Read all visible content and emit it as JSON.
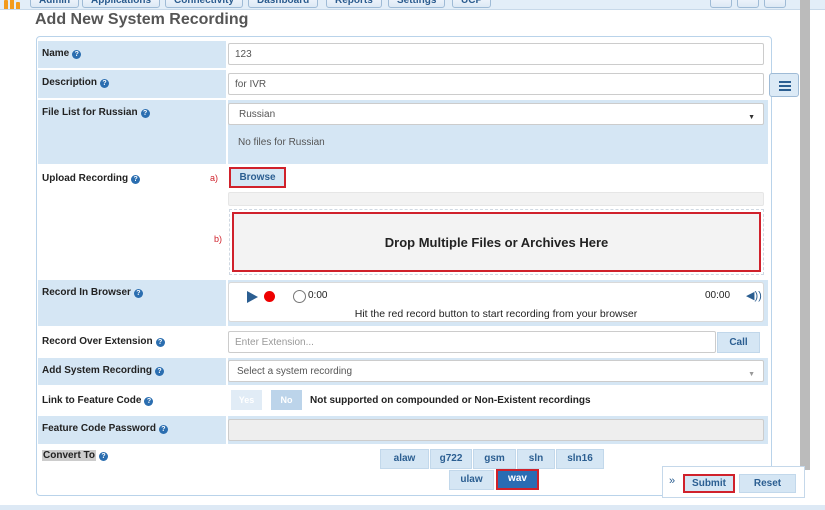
{
  "nav": {
    "tabs": [
      "Admin",
      "Applications",
      "Connectivity",
      "Dashboard",
      "Reports",
      "Settings",
      "UCP"
    ]
  },
  "page": {
    "title": "Add New System Recording"
  },
  "form": {
    "name": {
      "label": "Name",
      "value": "123"
    },
    "description": {
      "label": "Description",
      "value": "for IVR"
    },
    "file_list": {
      "label": "File List for Russian",
      "selected": "Russian",
      "note": "No files for Russian"
    },
    "upload": {
      "label": "Upload Recording",
      "marker_a": "a)",
      "marker_b": "b)",
      "browse_label": "Browse",
      "dropzone_text": "Drop Multiple Files or Archives Here"
    },
    "record_browser": {
      "label": "Record In Browser",
      "time_current": "0:00",
      "time_total": "00:00",
      "hint": "Hit the red record button to start recording from your browser"
    },
    "record_extension": {
      "label": "Record Over Extension",
      "placeholder": "Enter Extension...",
      "call_label": "Call"
    },
    "add_system_recording": {
      "label": "Add System Recording",
      "placeholder": "Select a system recording"
    },
    "feature_code": {
      "label": "Link to Feature Code",
      "yes": "Yes",
      "no": "No",
      "note": "Not supported on compounded or Non-Existent recordings"
    },
    "feature_password": {
      "label": "Feature Code Password"
    },
    "convert": {
      "label": "Convert To",
      "formats_row1": [
        "alaw",
        "g722",
        "gsm",
        "sln",
        "sln16"
      ],
      "formats_row2": [
        "ulaw",
        "wav"
      ],
      "active": "wav"
    }
  },
  "footer": {
    "expand": "»",
    "submit_label": "Submit",
    "reset_label": "Reset"
  },
  "colors": {
    "accent": "#2a6cb3",
    "highlight": "#d0212b",
    "label_bg": "#d5e6f4"
  }
}
